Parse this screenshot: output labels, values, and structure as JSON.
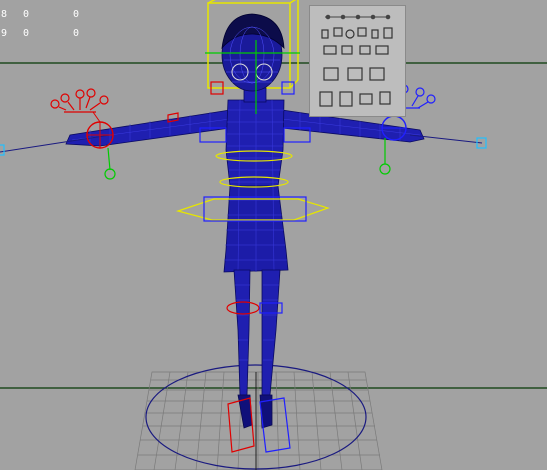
{
  "viewport": {
    "name": "perspective-viewport",
    "hud": {
      "rows": [
        [
          "8",
          "0",
          "0"
        ],
        [
          "9",
          "0",
          "0"
        ]
      ]
    }
  },
  "scene": {
    "background_color": "#a2a2a2",
    "mesh_color": "#1a1aa0",
    "mesh_light_color": "#3b3be0",
    "grid_color": "#777777",
    "horizon_color": "#1a4a1a",
    "control_yellow": "#e6e600",
    "control_red": "#e00000",
    "control_blue": "#2020ff",
    "control_green": "#00cc00",
    "control_cyan": "#20c0ff"
  },
  "picker_panel": {
    "name": "character-picker-panel",
    "background": "#bdbdbd"
  }
}
